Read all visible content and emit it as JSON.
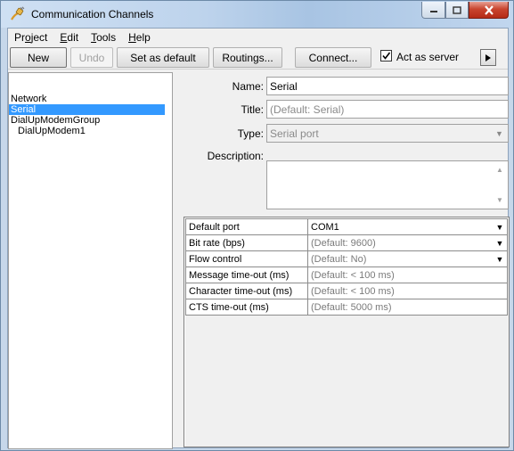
{
  "window": {
    "title": "Communication Channels"
  },
  "menu": [
    {
      "label": "Project",
      "mnemonic_index": 2
    },
    {
      "label": "Edit",
      "mnemonic_index": 0
    },
    {
      "label": "Tools",
      "mnemonic_index": 0
    },
    {
      "label": "Help",
      "mnemonic_index": 0
    }
  ],
  "toolbar": {
    "new_label": "New",
    "undo_label": "Undo",
    "set_default_label": "Set as default",
    "routings_label": "Routings...",
    "connect_label": "Connect...",
    "act_as_server_label": "Act as server",
    "act_as_server_checked": true
  },
  "tree": {
    "items": [
      {
        "label": "Network",
        "selected": false,
        "indent": false
      },
      {
        "label": "Serial",
        "selected": true,
        "indent": false
      },
      {
        "label": "DialUpModemGroup",
        "selected": false,
        "indent": false
      },
      {
        "label": "DialUpModem1",
        "selected": false,
        "indent": true
      }
    ]
  },
  "form": {
    "name_label": "Name:",
    "name_value": "Serial",
    "title_label": "Title:",
    "title_placeholder": "(Default: Serial)",
    "type_label": "Type:",
    "type_value": "Serial port",
    "description_label": "Description:",
    "description_value": ""
  },
  "properties": [
    {
      "key": "Default port",
      "value": "COM1",
      "dim": false,
      "dropdown": true
    },
    {
      "key": "Bit rate (bps)",
      "value": "(Default: 9600)",
      "dim": true,
      "dropdown": true
    },
    {
      "key": "Flow control",
      "value": "(Default: No)",
      "dim": true,
      "dropdown": true
    },
    {
      "key": "Message time-out (ms)",
      "value": "(Default: < 100 ms)",
      "dim": true,
      "dropdown": false
    },
    {
      "key": "Character time-out (ms)",
      "value": "(Default: < 100 ms)",
      "dim": true,
      "dropdown": false
    },
    {
      "key": "CTS time-out (ms)",
      "value": "(Default: 5000 ms)",
      "dim": true,
      "dropdown": false
    }
  ],
  "colors": {
    "selection": "#3399ff",
    "close_button": "#c9452f"
  }
}
